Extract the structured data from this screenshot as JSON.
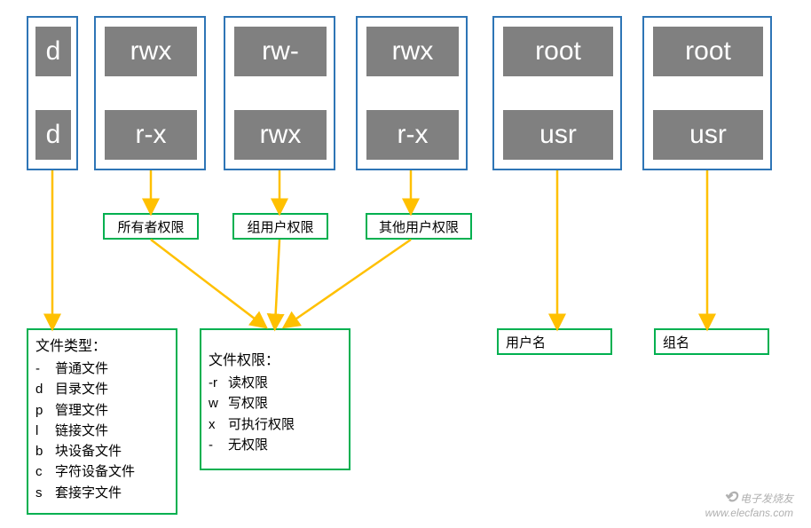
{
  "columns": [
    {
      "top": "d",
      "bottom": "d",
      "midLabel": null
    },
    {
      "top": "rwx",
      "bottom": "r-x",
      "midLabel": "所有者权限"
    },
    {
      "top": "rw-",
      "bottom": "rwx",
      "midLabel": "组用户权限"
    },
    {
      "top": "rwx",
      "bottom": "r-x",
      "midLabel": "其他用户权限"
    },
    {
      "top": "root",
      "bottom": "usr",
      "bottomLabel": "用户名"
    },
    {
      "top": "root",
      "bottom": "usr",
      "bottomLabel": "组名"
    }
  ],
  "fileTypeLegend": {
    "title": "文件类型：",
    "items": [
      {
        "key": "-",
        "desc": "普通文件"
      },
      {
        "key": "d",
        "desc": "目录文件"
      },
      {
        "key": "p",
        "desc": "管理文件"
      },
      {
        "key": "l",
        "desc": "链接文件"
      },
      {
        "key": "b",
        "desc": "块设备文件"
      },
      {
        "key": "c",
        "desc": "字符设备文件"
      },
      {
        "key": "s",
        "desc": "套接字文件"
      }
    ]
  },
  "permLegend": {
    "title": "文件权限：",
    "items": [
      {
        "key": "-r",
        "desc": "读权限"
      },
      {
        "key": "w",
        "desc": "写权限"
      },
      {
        "key": "x",
        "desc": "可执行权限"
      },
      {
        "key": "-",
        "desc": "无权限"
      }
    ]
  },
  "watermark": {
    "name": "电子发烧友",
    "url": "www.elecfans.com"
  },
  "colors": {
    "blueBorder": "#2e75b6",
    "greenBorder": "#00b050",
    "grayFill": "#808080",
    "arrowColor": "#ffc000"
  }
}
